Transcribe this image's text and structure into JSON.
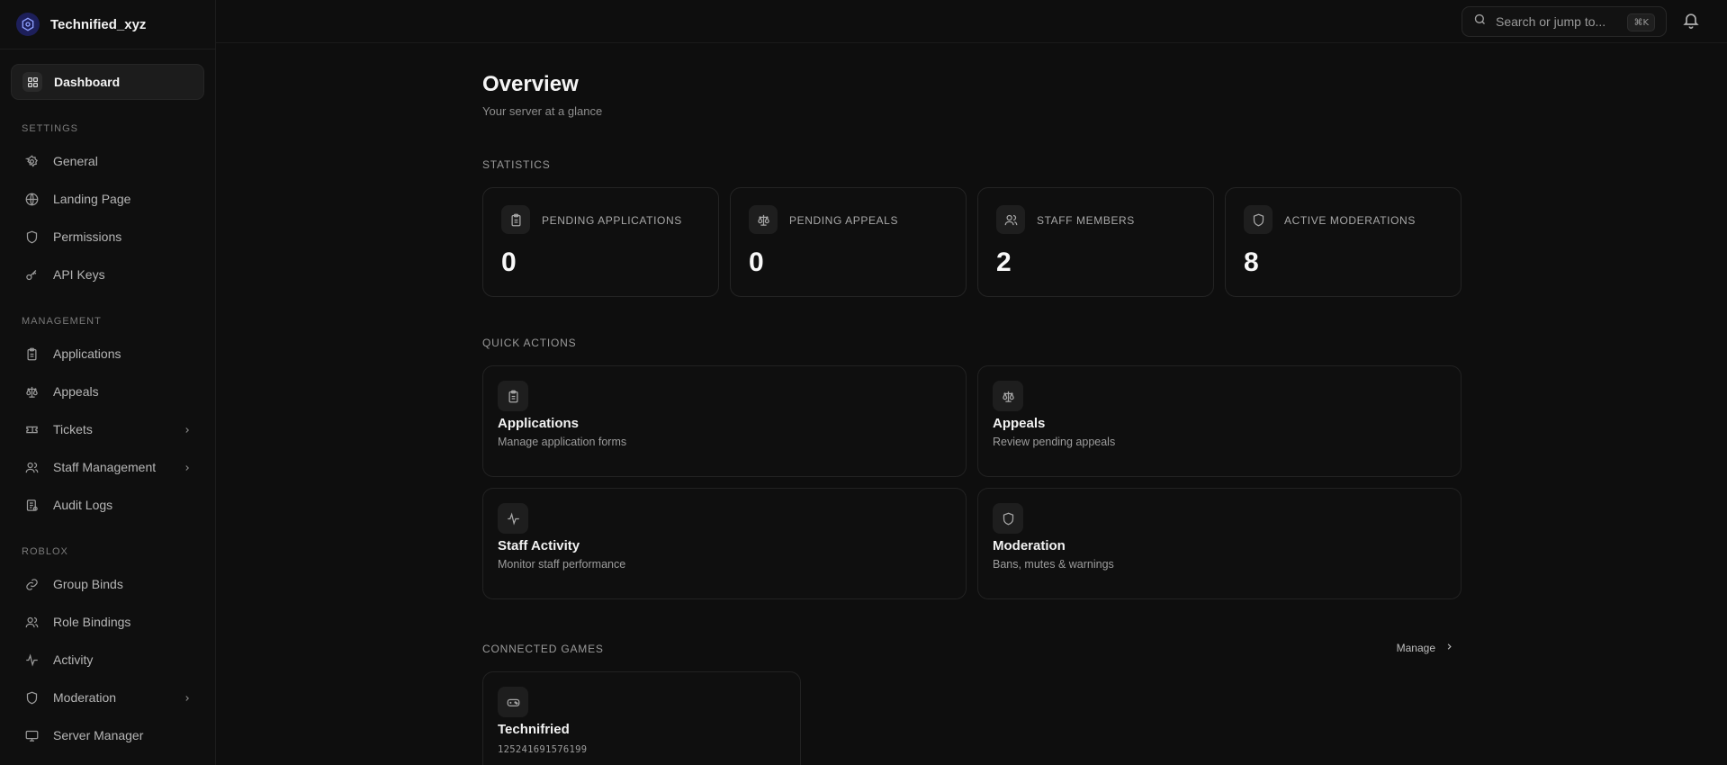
{
  "brand": {
    "name": "Technified_xyz"
  },
  "sidebar": {
    "dashboard": "Dashboard",
    "sections": [
      {
        "label": "SETTINGS",
        "items": [
          {
            "label": "General",
            "icon": "gear-icon"
          },
          {
            "label": "Landing Page",
            "icon": "globe-icon"
          },
          {
            "label": "Permissions",
            "icon": "shield-icon"
          },
          {
            "label": "API Keys",
            "icon": "key-icon"
          }
        ]
      },
      {
        "label": "MANAGEMENT",
        "items": [
          {
            "label": "Applications",
            "icon": "clipboard-icon"
          },
          {
            "label": "Appeals",
            "icon": "scale-icon"
          },
          {
            "label": "Tickets",
            "icon": "ticket-icon",
            "expandable": true
          },
          {
            "label": "Staff Management",
            "icon": "users-icon",
            "expandable": true
          },
          {
            "label": "Audit Logs",
            "icon": "log-icon"
          }
        ]
      },
      {
        "label": "ROBLOX",
        "items": [
          {
            "label": "Group Binds",
            "icon": "link-icon"
          },
          {
            "label": "Role Bindings",
            "icon": "users-icon"
          },
          {
            "label": "Activity",
            "icon": "activity-icon"
          },
          {
            "label": "Moderation",
            "icon": "shield-icon",
            "expandable": true
          },
          {
            "label": "Server Manager",
            "icon": "monitor-icon"
          }
        ]
      }
    ]
  },
  "topbar": {
    "search_placeholder": "Search or jump to...",
    "shortcut": "⌘K"
  },
  "main": {
    "title": "Overview",
    "subtitle": "Your server at a glance",
    "statistics_label": "STATISTICS",
    "stats": [
      {
        "label": "PENDING APPLICATIONS",
        "value": "0",
        "icon": "clipboard-icon"
      },
      {
        "label": "PENDING APPEALS",
        "value": "0",
        "icon": "scale-icon"
      },
      {
        "label": "STAFF MEMBERS",
        "value": "2",
        "icon": "users-icon"
      },
      {
        "label": "ACTIVE MODERATIONS",
        "value": "8",
        "icon": "shield-icon"
      }
    ],
    "quick_actions_label": "QUICK ACTIONS",
    "quick_actions": [
      {
        "title": "Applications",
        "desc": "Manage application forms",
        "icon": "clipboard-icon"
      },
      {
        "title": "Appeals",
        "desc": "Review pending appeals",
        "icon": "scale-icon"
      },
      {
        "title": "Staff Activity",
        "desc": "Monitor staff performance",
        "icon": "activity-icon"
      },
      {
        "title": "Moderation",
        "desc": "Bans, mutes & warnings",
        "icon": "shield-icon"
      }
    ],
    "connected_games_label": "CONNECTED GAMES",
    "manage_label": "Manage",
    "games": [
      {
        "name": "Technifried",
        "id": "125241691576199",
        "icon": "gamepad-icon"
      }
    ]
  }
}
